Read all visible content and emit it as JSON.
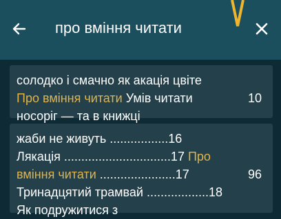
{
  "toolbar": {
    "query": "про вміння читати"
  },
  "results": [
    {
      "lines": [
        [
          {
            "text": "солодко і смачно як акація цвіте",
            "hl": false
          }
        ],
        [
          {
            "text": "Про вміння читати",
            "hl": true
          },
          {
            "text": " Умів читати",
            "hl": false
          }
        ],
        [
          {
            "text": "носоріг — та в книжці",
            "hl": false
          }
        ]
      ],
      "page": "10"
    },
    {
      "lines": [
        [
          {
            "text": "жаби не живуть .................16",
            "hl": false
          }
        ],
        [
          {
            "text": "Лякація ...............................17 ",
            "hl": false
          },
          {
            "text": "Про",
            "hl": true
          }
        ],
        [
          {
            "text": "вміння читати",
            "hl": true
          },
          {
            "text": " ......................17",
            "hl": false
          }
        ],
        [
          {
            "text": "Тринадцятий трамвай ..................18",
            "hl": false
          }
        ],
        [
          {
            "text": "Як подружитися з",
            "hl": false
          }
        ]
      ],
      "page": "96"
    }
  ],
  "colors": {
    "toolbar_bg": "#1c4f5e",
    "card_bg": "#24404b",
    "highlight": "#e3b445",
    "pointer": "#f0b52e"
  }
}
